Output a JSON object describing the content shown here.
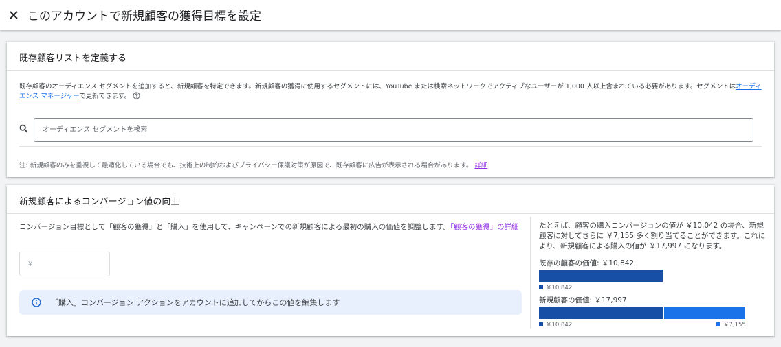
{
  "header": {
    "title": "このアカウントで新規顧客の獲得目標を設定"
  },
  "existing_list": {
    "heading": "既存顧客リストを定義する",
    "description": "既存顧客のオーディエンス セグメントを追加すると、新規顧客を特定できます。新規顧客の獲得に使用するセグメントには、YouTube または検索ネットワークでアクティブなユーザーが 1,000 人以上含まれている必要があります。セグメントは",
    "manager_link": "オーディエンス マネージャー",
    "description_suffix": "で更新できます。",
    "search_placeholder": "オーディエンス セグメントを検索",
    "note": "注: 新規顧客のみを重視して最適化している場合でも、技術上の制約およびプライバシー保護対策が原因で、既存顧客に広告が表示される場合があります。",
    "details_link": "詳細"
  },
  "value_uplift": {
    "heading": "新規顧客によるコンバージョン値の向上",
    "description": "コンバージョン目標として「顧客の獲得」と「購入」を使用して、キャンペーンでの新規顧客による最初の購入の価値を調整します。",
    "acquisition_link": "「顧客の獲得」の詳細",
    "amount_placeholder": "¥",
    "info_text": "「購入」コンバージョン アクションをアカウントに追加してからこの値を編集します",
    "example": {
      "text": "たとえば、顧客の購入コンバージョンの値が ￥10,042 の場合、新規顧客に対してさらに ￥7,155 多く割り当てることができます。これにより、新規顧客による購入の値が ￥17,997 になります。",
      "existing_label": "既存の顧客の価値: ￥10,842",
      "new_label": "新規顧客の価値: ￥17,997",
      "base_legend": "￥10,842",
      "extra_legend": "￥7,155",
      "base_value": 10842,
      "extra_value": 7155,
      "base_color": "#174ea6",
      "extra_color": "#1a73e8"
    }
  },
  "colors": {
    "link": "#1a73e8",
    "visited_link": "#9334e6",
    "info_bg": "#e8f0fe",
    "info_icon": "#1967d2"
  }
}
